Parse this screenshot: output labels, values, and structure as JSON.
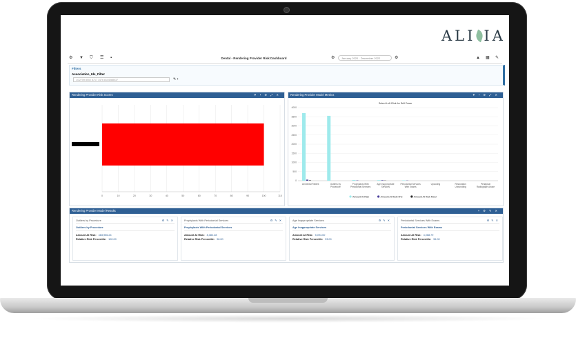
{
  "brand": {
    "logo_left": "ALI",
    "logo_right": "IA"
  },
  "toolbar": {
    "title": "Dental - Rendering Provider Risk Dashboard",
    "date_range": "January 2020 - December 2022",
    "left_icons": [
      "gear-icon",
      "filter-icon",
      "shield-icon",
      "layers-icon",
      "save-icon"
    ],
    "right_icons": [
      "user-icon",
      "grid-icon",
      "brush-icon"
    ]
  },
  "filters": {
    "header": "Filters",
    "label": "Association_Ids_Filter",
    "value": "1/32759 8002 8717 1476 8144088037"
  },
  "panel_risk": {
    "title": "Rendering Provider Risk Scores",
    "legend": "Risk Score",
    "chart_data": {
      "type": "bar",
      "orientation": "horizontal",
      "categories": [
        ""
      ],
      "series": [
        {
          "name": "Risk Score",
          "values": [
            100
          ]
        }
      ],
      "xlim": [
        0,
        110
      ],
      "xticks": [
        "0",
        "10",
        "20",
        "30",
        "40",
        "50",
        "60",
        "70",
        "80",
        "90",
        "100",
        "110"
      ]
    }
  },
  "panel_model": {
    "title": "Rendering Provider Model Metrics",
    "subtitle": "Select Left Click for Drill Down",
    "chart_data": {
      "type": "bar",
      "categories": [
        "All Dental Patient",
        "Outliers by Procedure",
        "Prophylaxis With Periodontal Services",
        "Age Inappropriate Services",
        "Periodontal Services With Exams",
        "Upcoding",
        "Restoration Unbundling",
        "Periapical Radiograph Abuse"
      ],
      "yticks": [
        "0",
        "500",
        "1000",
        "1500",
        "2000",
        "2500",
        "3000",
        "3500",
        "4000"
      ],
      "ylim": [
        0,
        4000
      ],
      "series": [
        {
          "name": "Amount At Risk",
          "color": "#9eeaec",
          "values": [
            3700,
            3550,
            40,
            30,
            20,
            0,
            0,
            0
          ]
        },
        {
          "name": "Amount At Risk HFS",
          "color": "#4b3f9c",
          "values": [
            60,
            0,
            15,
            25,
            10,
            0,
            0,
            0
          ]
        },
        {
          "name": "Amount At Risk MCO",
          "color": "#2a2a2a",
          "values": [
            20,
            0,
            0,
            10,
            0,
            0,
            0,
            0
          ]
        }
      ]
    }
  },
  "panel_results": {
    "title": "Rendering Provider Model Results",
    "cards": [
      {
        "title": "Outliers by Procedure",
        "subtitle": "Outliers by Procedure",
        "amount_label": "Amount At Risk:",
        "amount": "483,956.24",
        "percentile_label": "Relative Risk Percentile:",
        "percentile": "100.00"
      },
      {
        "title": "Prophylaxis With Periodontal Services",
        "subtitle": "Prophylaxis With Periodontal Services",
        "amount_label": "Amount At Risk:",
        "amount": "8,382.28",
        "percentile_label": "Relative Risk Percentile:",
        "percentile": "98.00"
      },
      {
        "title": "Age Inappropriate Services",
        "subtitle": "Age Inappropriate Services",
        "amount_label": "Amount At Risk:",
        "amount": "5,094.00",
        "percentile_label": "Relative Risk Percentile:",
        "percentile": "93.00"
      },
      {
        "title": "Periodontal Services With Exams",
        "subtitle": "Periodontal Services With Exams",
        "amount_label": "Amount At Risk:",
        "amount": "4,068.79",
        "percentile_label": "Relative Risk Percentile:",
        "percentile": "96.00"
      }
    ]
  },
  "colors": {
    "header": "#2e5f94",
    "risk_bar": "#ff0000",
    "accent": "#2f6ea3"
  }
}
